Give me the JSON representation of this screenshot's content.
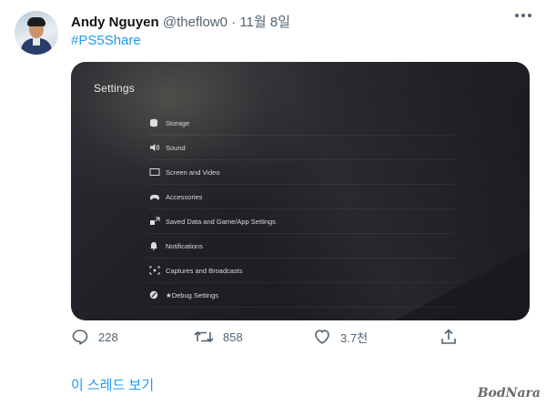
{
  "tweet": {
    "author_name": "Andy Nguyen",
    "author_handle": "@theflow0",
    "separator": "·",
    "date": "11월 8일",
    "hashtag": "#PS5Share"
  },
  "screenshot": {
    "title": "Settings",
    "menu": [
      {
        "icon": "storage-icon",
        "label": "Storage"
      },
      {
        "icon": "sound-icon",
        "label": "Sound"
      },
      {
        "icon": "screen-icon",
        "label": "Screen and Video"
      },
      {
        "icon": "accessories-icon",
        "label": "Accessories"
      },
      {
        "icon": "saved-data-icon",
        "label": "Saved Data and Game/App Settings"
      },
      {
        "icon": "bell-icon",
        "label": "Notifications"
      },
      {
        "icon": "captures-icon",
        "label": "Captures and Broadcasts"
      },
      {
        "icon": "debug-icon",
        "label": "★Debug Settings"
      }
    ]
  },
  "actions": {
    "reply_count": "228",
    "retweet_count": "858",
    "like_count": "3.7천"
  },
  "thread_link": "이 스레드 보기",
  "watermark": "BodNara",
  "colors": {
    "link": "#1d9bf0",
    "secondary": "#536471",
    "text": "#0f1419"
  }
}
